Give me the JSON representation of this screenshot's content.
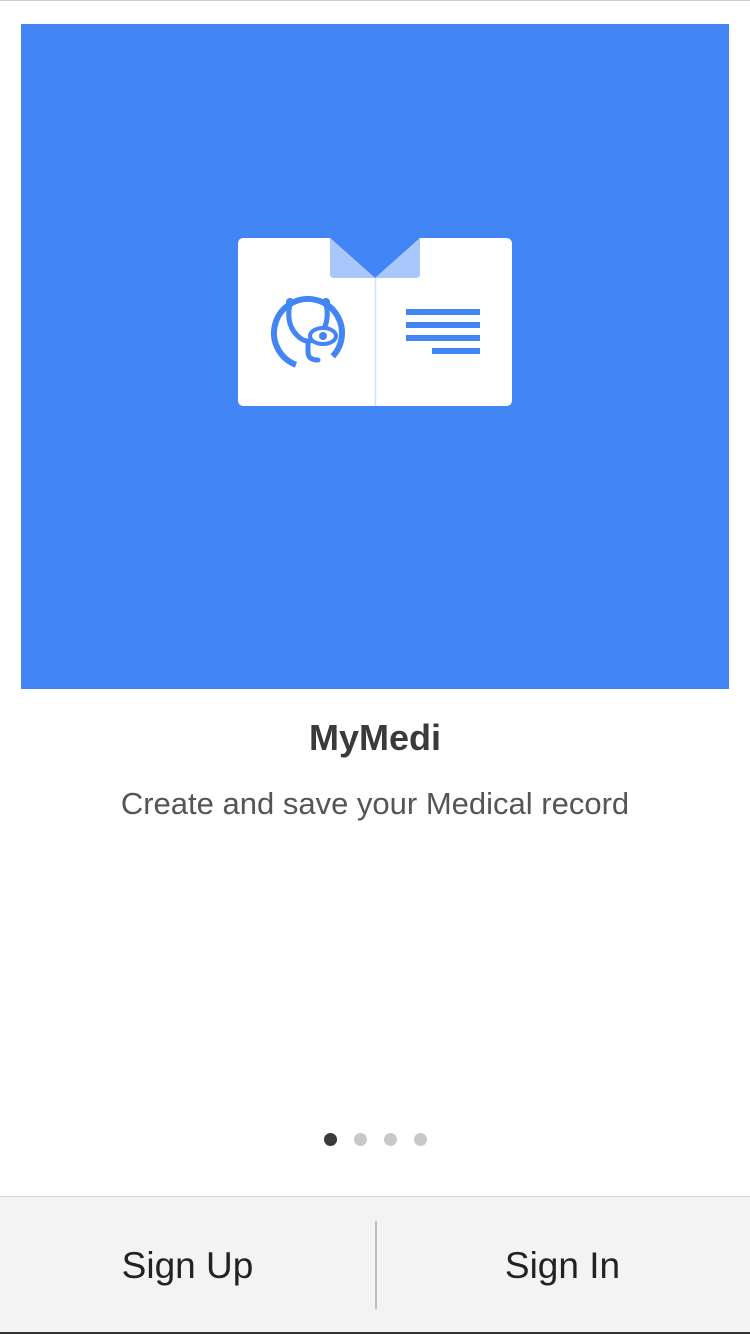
{
  "onboarding": {
    "app_name": "MyMedi",
    "tagline": "Create and save your Medical record",
    "pager": {
      "total": 4,
      "active_index": 0
    }
  },
  "actions": {
    "sign_up_label": "Sign Up",
    "sign_in_label": "Sign In"
  },
  "icons": {
    "hero": "medical-record-book-icon",
    "stethoscope": "stethoscope-eye-icon",
    "text_lines": "document-lines-icon"
  },
  "colors": {
    "hero_background": "#4285f4",
    "book_page": "#ffffff",
    "book_ribbon": "#a9c7fb",
    "icon_blue": "#4285f4",
    "dot_active": "#3a3a3a",
    "dot_inactive": "#c8c8c8",
    "bottom_bar": "#f4f3f3"
  }
}
